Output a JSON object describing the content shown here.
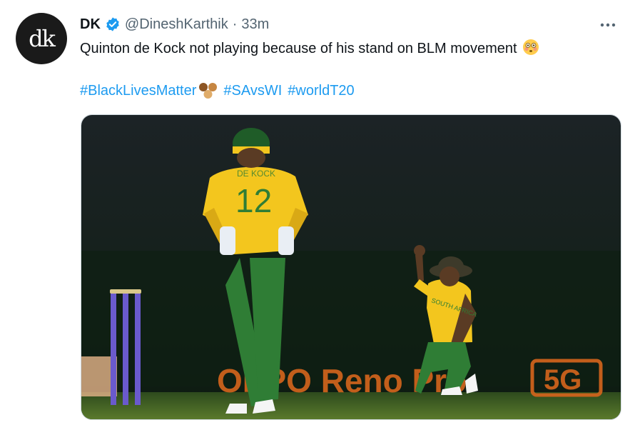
{
  "author": {
    "name": "DK",
    "handle": "@DineshKarthik",
    "separator": "·",
    "time": "33m",
    "avatar_text": "dk"
  },
  "tweet": {
    "text": "Quinton de Kock not playing because of his stand on BLM movement",
    "emoji": "flushed-face-emoji",
    "hashtags": [
      "#BlackLivesMatter",
      "#SAvsWI",
      "#worldT20"
    ],
    "hashtag_emoji": "raised-fist-multiple-skin-tones-emoji"
  },
  "media": {
    "jersey_number": "12",
    "jersey_name": "DE KOCK",
    "kneeling_jersey_text": "SOUTH AFRICA",
    "sponsor_text": "OPPO Reno Pro",
    "sponsor_badge": "5G"
  },
  "colors": {
    "link": "#1d9bf0",
    "secondary_text": "#536471",
    "verified": "#1d9bf0",
    "jersey_yellow": "#f3c61e",
    "trouser_green": "#2f7d35"
  },
  "icons": {
    "verified": "verified-badge-icon",
    "more": "more-options-icon"
  }
}
